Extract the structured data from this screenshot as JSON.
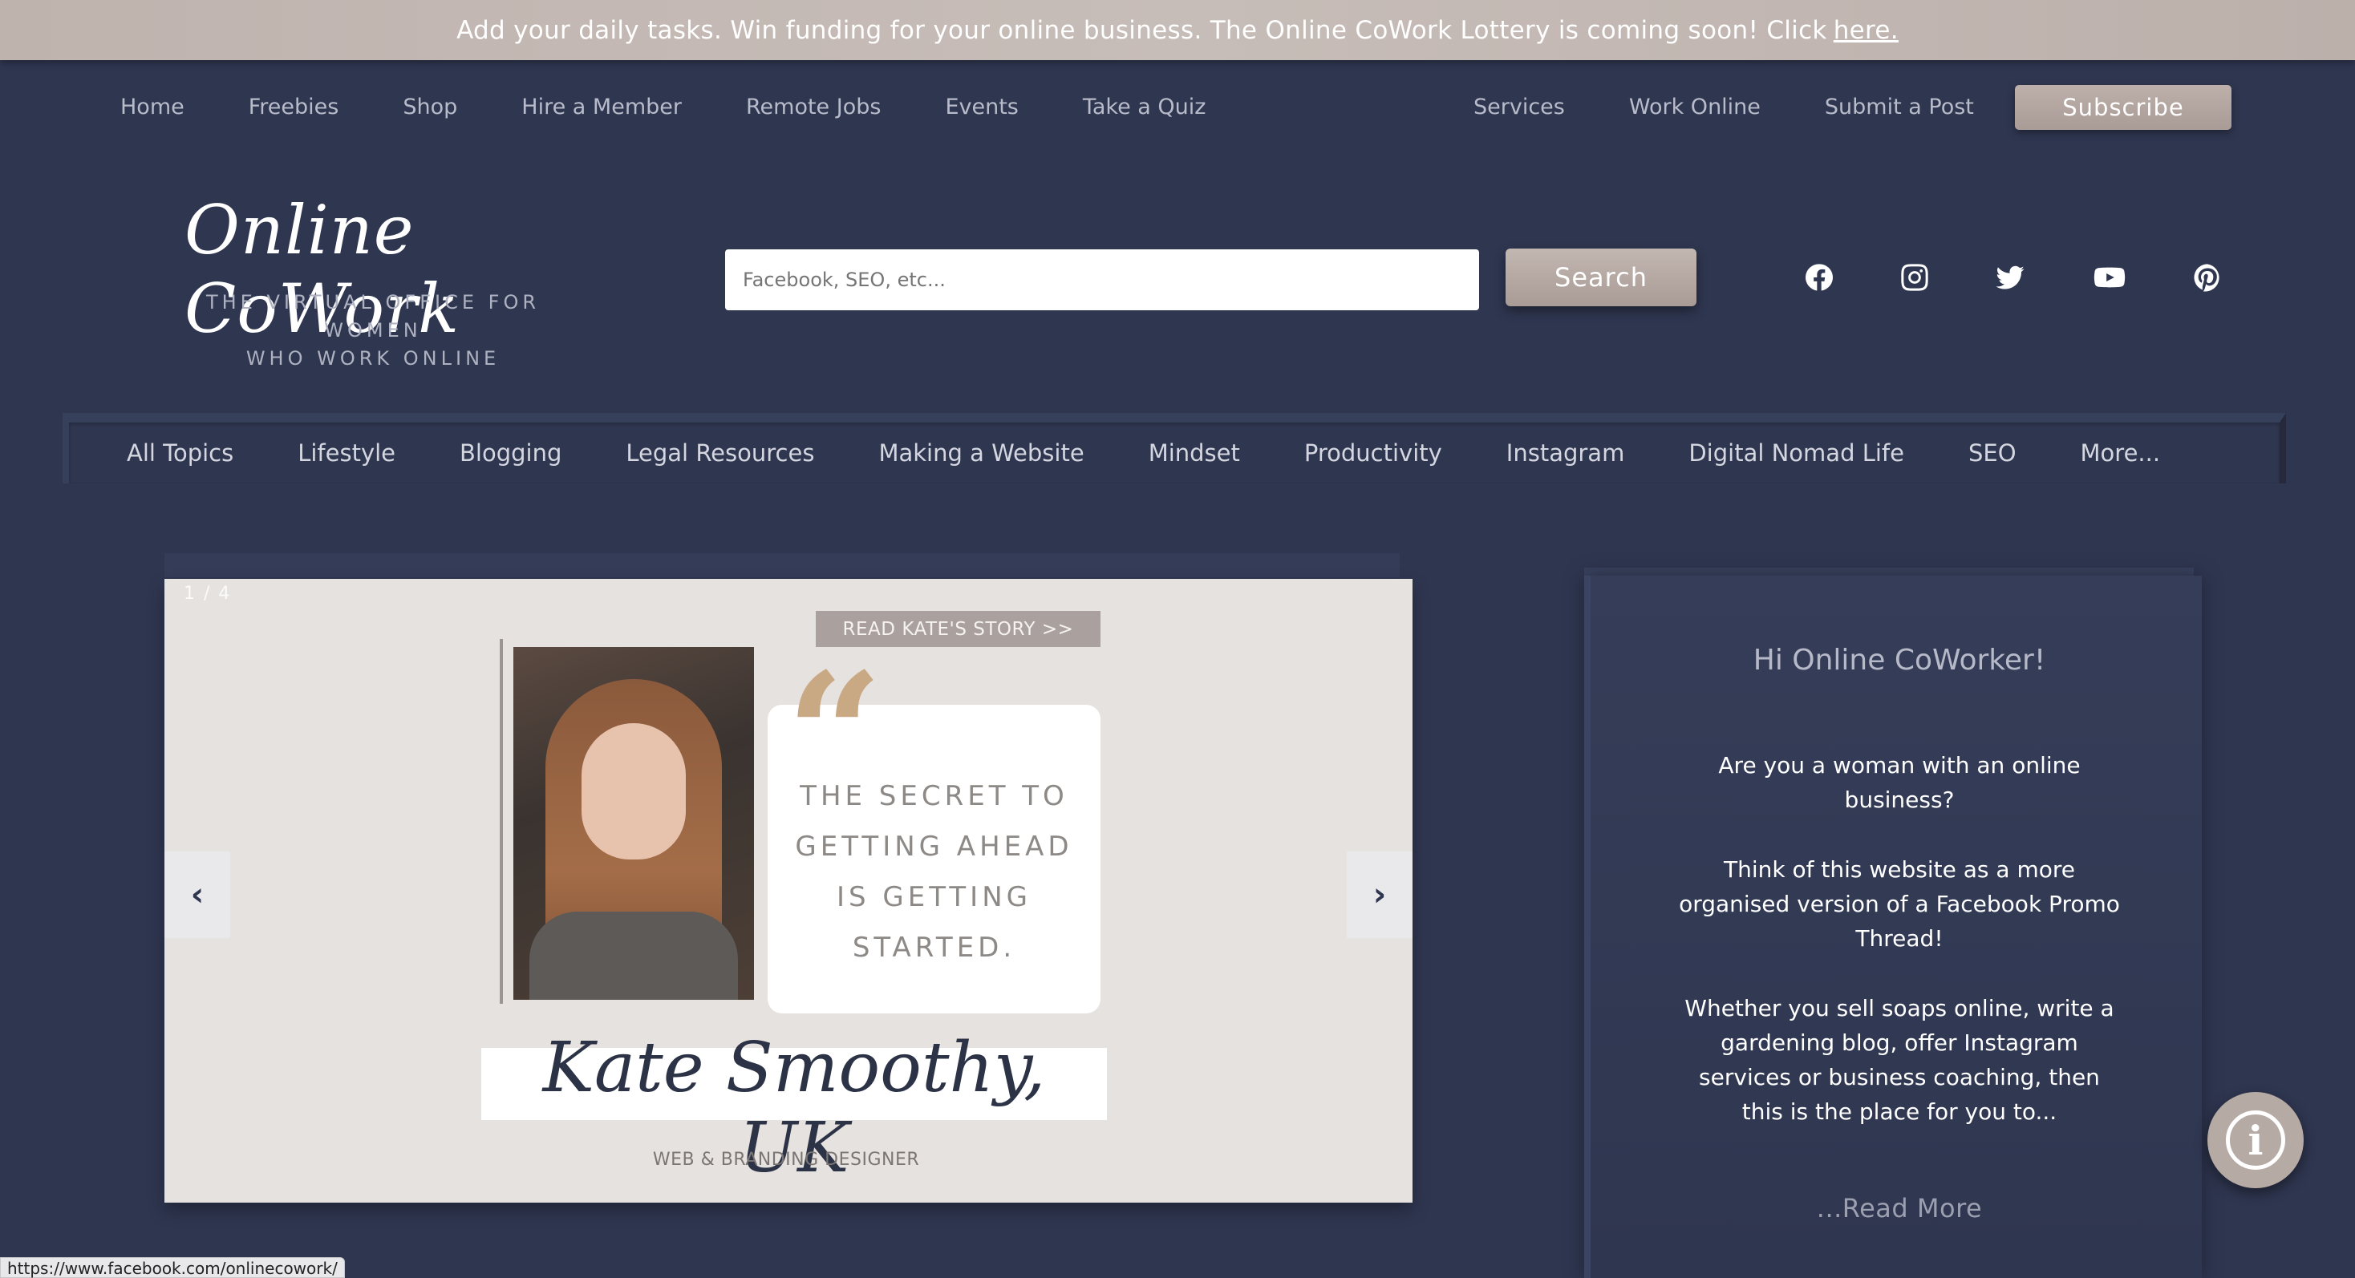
{
  "announcement": {
    "text": "Add your daily tasks. Win funding for your online business. The Online CoWork Lottery is coming soon! Click",
    "link_text": "here."
  },
  "topnav": {
    "left_items": [
      "Home",
      "Freebies",
      "Shop",
      "Hire a Member",
      "Remote Jobs",
      "Events",
      "Take a Quiz"
    ],
    "right_items": [
      "Services",
      "Work Online",
      "Submit a Post"
    ],
    "subscribe_label": "Subscribe"
  },
  "logo": {
    "script": "Online CoWork",
    "tagline_line1": "THE VIRTUAL OFFICE FOR WOMEN",
    "tagline_line2": "WHO WORK ONLINE"
  },
  "search": {
    "placeholder": "Facebook, SEO, etc...",
    "button_label": "Search"
  },
  "social": {
    "icons": [
      "facebook-icon",
      "instagram-icon",
      "twitter-icon",
      "youtube-icon",
      "pinterest-icon"
    ]
  },
  "categories": [
    "All Topics",
    "Lifestyle",
    "Blogging",
    "Legal Resources",
    "Making a Website",
    "Mindset",
    "Productivity",
    "Instagram",
    "Digital Nomad Life",
    "SEO",
    "More..."
  ],
  "slider": {
    "counter": "1 / 4",
    "story_button": "READ KATE'S STORY >>",
    "quote_lines": [
      "THE SECRET TO",
      "GETTING AHEAD",
      "IS GETTING",
      "STARTED."
    ],
    "name": "Kate Smoothy, UK",
    "role": "WEB & BRANDING DESIGNER",
    "prev_label": "‹",
    "next_label": "›"
  },
  "sidebar": {
    "title": "Hi Online CoWorker!",
    "p1": "Are you a woman with an online business?",
    "p2": "Think of this website as a more organised version of a Facebook Promo Thread!",
    "p3": "Whether you sell soaps online, write a gardening blog, offer Instagram services or business coaching, then this is the place for you to...",
    "read_more": "...Read More"
  },
  "status_bar": {
    "url": "https://www.facebook.com/onlinecowork/"
  },
  "colors": {
    "background": "#2f3650",
    "accent": "#b6aaa5",
    "slide_bg": "#e6e2df",
    "quote_mark": "#c9a884"
  }
}
